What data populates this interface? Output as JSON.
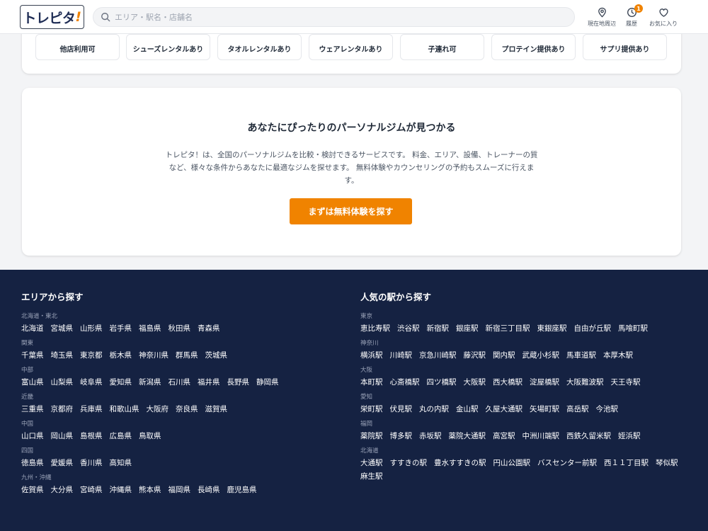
{
  "header": {
    "logo_text": "トレピタ",
    "logo_mark": "!",
    "search_placeholder": "エリア・駅名・店舗名",
    "nav": [
      {
        "label": "現在地周辺",
        "icon": "location-pin-icon"
      },
      {
        "label": "履歴",
        "icon": "clock-icon",
        "badge": "1"
      },
      {
        "label": "お気に入り",
        "icon": "heart-icon"
      }
    ]
  },
  "features": [
    "他店利用可",
    "シューズレンタルあり",
    "タオルレンタルあり",
    "ウェアレンタルあり",
    "子連れ可",
    "プロテイン提供あり",
    "サプリ提供あり"
  ],
  "about": {
    "title": "あなたにぴったりのパーソナルジムが見つかる",
    "description": "トレピタ！は、全国のパーソナルジムを比較・検討できるサービスです。 料金、エリア、設備、トレーナーの質など、様々な条件からあなたに最適なジムを探せます。 無料体験やカウンセリングの予約もスムーズに行えます。",
    "cta_label": "まずは無料体験を探す"
  },
  "footer": {
    "area": {
      "title": "エリアから探す",
      "groups": [
        {
          "label": "北海道・東北",
          "items": [
            "北海道",
            "宮城県",
            "山形県",
            "岩手県",
            "福島県",
            "秋田県",
            "青森県"
          ]
        },
        {
          "label": "関東",
          "items": [
            "千葉県",
            "埼玉県",
            "東京都",
            "栃木県",
            "神奈川県",
            "群馬県",
            "茨城県"
          ]
        },
        {
          "label": "中部",
          "items": [
            "富山県",
            "山梨県",
            "岐阜県",
            "愛知県",
            "新潟県",
            "石川県",
            "福井県",
            "長野県",
            "静岡県"
          ]
        },
        {
          "label": "近畿",
          "items": [
            "三重県",
            "京都府",
            "兵庫県",
            "和歌山県",
            "大阪府",
            "奈良県",
            "滋賀県"
          ]
        },
        {
          "label": "中国",
          "items": [
            "山口県",
            "岡山県",
            "島根県",
            "広島県",
            "鳥取県"
          ]
        },
        {
          "label": "四国",
          "items": [
            "徳島県",
            "愛媛県",
            "香川県",
            "高知県"
          ]
        },
        {
          "label": "九州・沖縄",
          "items": [
            "佐賀県",
            "大分県",
            "宮崎県",
            "沖縄県",
            "熊本県",
            "福岡県",
            "長崎県",
            "鹿児島県"
          ]
        }
      ]
    },
    "station": {
      "title": "人気の駅から探す",
      "groups": [
        {
          "label": "東京",
          "items": [
            "恵比寿駅",
            "渋谷駅",
            "新宿駅",
            "銀座駅",
            "新宿三丁目駅",
            "東銀座駅",
            "自由が丘駅",
            "馬喰町駅"
          ]
        },
        {
          "label": "神奈川",
          "items": [
            "横浜駅",
            "川崎駅",
            "京急川崎駅",
            "藤沢駅",
            "関内駅",
            "武蔵小杉駅",
            "馬車道駅",
            "本厚木駅"
          ]
        },
        {
          "label": "大阪",
          "items": [
            "本町駅",
            "心斎橋駅",
            "四ツ橋駅",
            "大阪駅",
            "西大橋駅",
            "淀屋橋駅",
            "大阪難波駅",
            "天王寺駅"
          ]
        },
        {
          "label": "愛知",
          "items": [
            "栄町駅",
            "伏見駅",
            "丸の内駅",
            "金山駅",
            "久屋大通駅",
            "矢場町駅",
            "高岳駅",
            "今池駅"
          ]
        },
        {
          "label": "福岡",
          "items": [
            "薬院駅",
            "博多駅",
            "赤坂駅",
            "薬院大通駅",
            "高宮駅",
            "中洲川端駅",
            "西鉄久留米駅",
            "姪浜駅"
          ]
        },
        {
          "label": "北海道",
          "items": [
            "大通駅",
            "すすきの駅",
            "豊水すすきの駅",
            "円山公園駅",
            "バスセンター前駅",
            "西１１丁目駅",
            "琴似駅",
            "麻生駅"
          ]
        }
      ]
    }
  }
}
